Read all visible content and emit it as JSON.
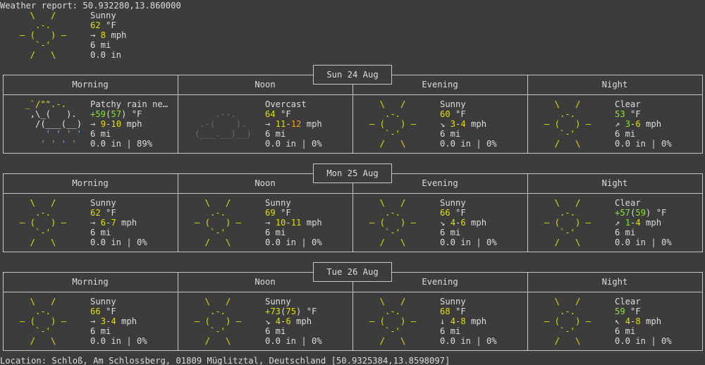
{
  "header": {
    "title": "Weather report: 50.932280,13.860000",
    "condition": "Sunny",
    "temp": "62",
    "temp_unit": "°F",
    "wind_arrow": "→",
    "wind": "8",
    "wind_unit": "mph",
    "visibility": "6 mi",
    "precip": "0.0 in"
  },
  "art": {
    "sunny": [
      "  \\   /  ",
      "   .-.   ",
      "― (   ) ―",
      "   `-'   ",
      "  /   \\  "
    ],
    "overcast": [
      "          ",
      "    .--.   ",
      " .-(    ).  ",
      "(___.__)__) ",
      "           "
    ],
    "rain_cloud": [
      " _`/\"\".-.  ",
      "  ,\\_(   ). ",
      "   /(___(__)",
      "     ' ' ' '",
      "    ' ' ' ' "
    ]
  },
  "columns": [
    "Morning",
    "Noon",
    "Evening",
    "Night"
  ],
  "days": [
    {
      "date": "Sun 24 Aug",
      "slots": [
        {
          "art": "rain_cloud",
          "condition": "Patchy rain ne…",
          "temp_parts": [
            [
              "+59",
              "green"
            ],
            [
              "(",
              ""
            ],
            [
              "57",
              "green"
            ],
            [
              ") °F",
              ""
            ]
          ],
          "wind_arrow": "→",
          "wind_parts": [
            [
              "9",
              "yellow"
            ],
            [
              "-",
              ""
            ],
            [
              "10",
              "yellow"
            ],
            [
              " mph",
              ""
            ]
          ],
          "visibility": "6 mi",
          "precip": "0.0 in | 89%"
        },
        {
          "art": "overcast",
          "condition": "Overcast",
          "temp_parts": [
            [
              "64",
              "yellow"
            ],
            [
              " °F",
              ""
            ]
          ],
          "wind_arrow": "→",
          "wind_parts": [
            [
              "11",
              "yellow"
            ],
            [
              "-",
              ""
            ],
            [
              "12",
              "orange"
            ],
            [
              " mph",
              ""
            ]
          ],
          "visibility": "6 mi",
          "precip": "0.0 in | 0%"
        },
        {
          "art": "sunny",
          "condition": "Sunny",
          "temp_parts": [
            [
              "60",
              "yellow"
            ],
            [
              " °F",
              ""
            ]
          ],
          "wind_arrow": "↘",
          "wind_parts": [
            [
              "3",
              "yellow"
            ],
            [
              "-",
              ""
            ],
            [
              "4",
              "yellow"
            ],
            [
              " mph",
              ""
            ]
          ],
          "visibility": "6 mi",
          "precip": "0.0 in | 0%"
        },
        {
          "art": "sunny",
          "condition": "Clear",
          "temp_parts": [
            [
              "53",
              "green"
            ],
            [
              " °F",
              ""
            ]
          ],
          "wind_arrow": "↗",
          "wind_parts": [
            [
              "3",
              "green"
            ],
            [
              "-",
              ""
            ],
            [
              "6",
              "yellow"
            ],
            [
              " mph",
              ""
            ]
          ],
          "visibility": "6 mi",
          "precip": "0.0 in | 0%"
        }
      ]
    },
    {
      "date": "Mon 25 Aug",
      "slots": [
        {
          "art": "sunny",
          "condition": "Sunny",
          "temp_parts": [
            [
              "62",
              "yellow"
            ],
            [
              " °F",
              ""
            ]
          ],
          "wind_arrow": "→",
          "wind_parts": [
            [
              "6",
              "yellow"
            ],
            [
              "-",
              ""
            ],
            [
              "7",
              "yellow"
            ],
            [
              " mph",
              ""
            ]
          ],
          "visibility": "6 mi",
          "precip": "0.0 in | 0%"
        },
        {
          "art": "sunny",
          "condition": "Sunny",
          "temp_parts": [
            [
              "69",
              "yellow"
            ],
            [
              " °F",
              ""
            ]
          ],
          "wind_arrow": "→",
          "wind_parts": [
            [
              "10",
              "yellow"
            ],
            [
              "-",
              ""
            ],
            [
              "11",
              "yellow"
            ],
            [
              " mph",
              ""
            ]
          ],
          "visibility": "6 mi",
          "precip": "0.0 in | 0%"
        },
        {
          "art": "sunny",
          "condition": "Sunny",
          "temp_parts": [
            [
              "66",
              "yellow"
            ],
            [
              " °F",
              ""
            ]
          ],
          "wind_arrow": "↘",
          "wind_parts": [
            [
              "4",
              "yellow"
            ],
            [
              "-",
              ""
            ],
            [
              "6",
              "yellow"
            ],
            [
              " mph",
              ""
            ]
          ],
          "visibility": "6 mi",
          "precip": "0.0 in | 0%"
        },
        {
          "art": "sunny",
          "condition": "Clear",
          "temp_parts": [
            [
              "+57",
              "green"
            ],
            [
              "(",
              ""
            ],
            [
              "59",
              "green"
            ],
            [
              ") °F",
              ""
            ]
          ],
          "wind_arrow": "↗",
          "wind_parts": [
            [
              "1",
              "green"
            ],
            [
              "-",
              ""
            ],
            [
              "4",
              "yellow"
            ],
            [
              " mph",
              ""
            ]
          ],
          "visibility": "6 mi",
          "precip": "0.0 in | 0%"
        }
      ]
    },
    {
      "date": "Tue 26 Aug",
      "slots": [
        {
          "art": "sunny",
          "condition": "Sunny",
          "temp_parts": [
            [
              "66",
              "yellow"
            ],
            [
              " °F",
              ""
            ]
          ],
          "wind_arrow": "→",
          "wind_parts": [
            [
              "3",
              "yellow"
            ],
            [
              "-",
              ""
            ],
            [
              "4",
              "yellow"
            ],
            [
              " mph",
              ""
            ]
          ],
          "visibility": "6 mi",
          "precip": "0.0 in | 0%"
        },
        {
          "art": "sunny",
          "condition": "Sunny",
          "temp_parts": [
            [
              "+73",
              "yellow"
            ],
            [
              "(",
              ""
            ],
            [
              "75",
              "yellow"
            ],
            [
              ") °F",
              ""
            ]
          ],
          "wind_arrow": "↘",
          "wind_parts": [
            [
              "4",
              "yellow"
            ],
            [
              "-",
              ""
            ],
            [
              "6",
              "yellow"
            ],
            [
              " mph",
              ""
            ]
          ],
          "visibility": "6 mi",
          "precip": "0.0 in | 0%"
        },
        {
          "art": "sunny",
          "condition": "Sunny",
          "temp_parts": [
            [
              "68",
              "yellow"
            ],
            [
              " °F",
              ""
            ]
          ],
          "wind_arrow": "↓",
          "wind_parts": [
            [
              "4",
              "yellow"
            ],
            [
              "-",
              ""
            ],
            [
              "8",
              "yellow"
            ],
            [
              " mph",
              ""
            ]
          ],
          "visibility": "6 mi",
          "precip": "0.0 in | 0%"
        },
        {
          "art": "sunny",
          "condition": "Clear",
          "temp_parts": [
            [
              "59",
              "green"
            ],
            [
              " °F",
              ""
            ]
          ],
          "wind_arrow": "↖",
          "wind_parts": [
            [
              "4",
              "yellow"
            ],
            [
              "-",
              ""
            ],
            [
              "8",
              "yellow"
            ],
            [
              " mph",
              ""
            ]
          ],
          "visibility": "6 mi",
          "precip": "0.0 in | 0%"
        }
      ]
    }
  ],
  "footer": {
    "location": "Location: Schloß, Am Schlossberg, 01809 Müglitztal, Deutschland [50.9325384,13.8598097]"
  }
}
